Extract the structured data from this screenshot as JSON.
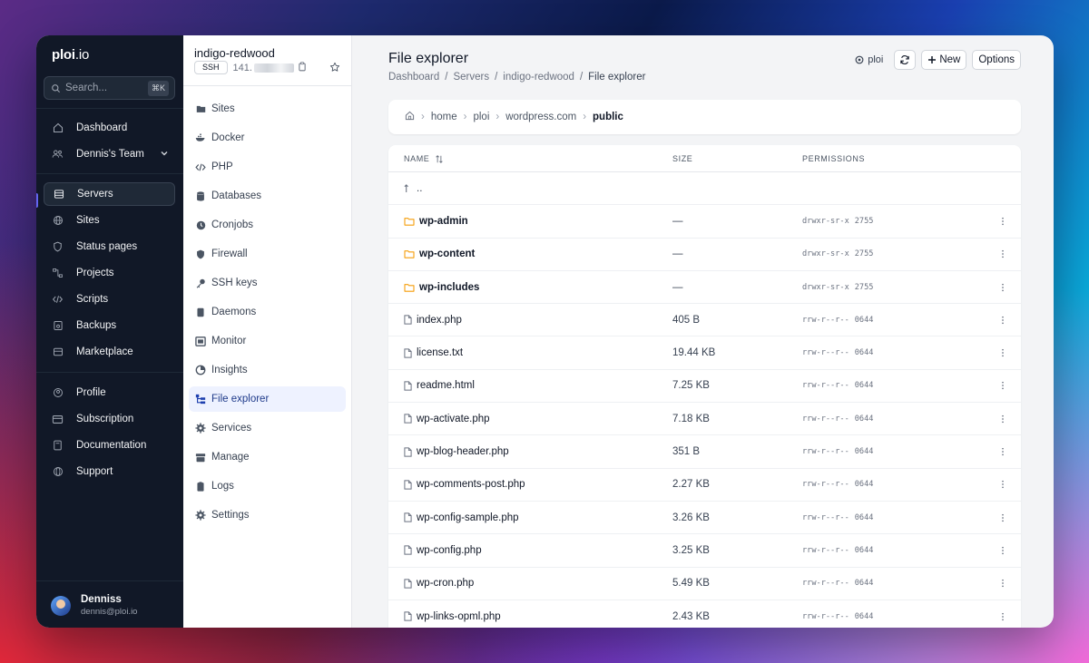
{
  "app": {
    "logo": "ploi",
    "logo_tld": ".io"
  },
  "search": {
    "placeholder": "Search...",
    "shortcut": "⌘K"
  },
  "main_nav": [
    {
      "label": "Dashboard",
      "icon": "home-icon"
    },
    {
      "label": "Dennis's Team",
      "icon": "team-icon",
      "has_dropdown": true
    }
  ],
  "resource_nav": [
    {
      "label": "Servers",
      "icon": "server-icon",
      "active": true
    },
    {
      "label": "Sites",
      "icon": "globe-icon"
    },
    {
      "label": "Status pages",
      "icon": "status-icon"
    },
    {
      "label": "Projects",
      "icon": "projects-icon"
    },
    {
      "label": "Scripts",
      "icon": "code-icon"
    },
    {
      "label": "Backups",
      "icon": "backup-icon"
    },
    {
      "label": "Marketplace",
      "icon": "store-icon"
    }
  ],
  "account_nav": [
    {
      "label": "Profile",
      "icon": "profile-icon"
    },
    {
      "label": "Subscription",
      "icon": "card-icon"
    },
    {
      "label": "Documentation",
      "icon": "book-icon"
    },
    {
      "label": "Support",
      "icon": "support-icon"
    }
  ],
  "user": {
    "name": "Denniss",
    "email": "dennis@ploi.io"
  },
  "server": {
    "name": "indigo-redwood",
    "ssh_label": "SSH",
    "ip_visible": "141."
  },
  "server_nav": [
    {
      "label": "Sites"
    },
    {
      "label": "Docker"
    },
    {
      "label": "PHP"
    },
    {
      "label": "Databases"
    },
    {
      "label": "Cronjobs"
    },
    {
      "label": "Firewall"
    },
    {
      "label": "SSH keys"
    },
    {
      "label": "Daemons"
    },
    {
      "label": "Monitor"
    },
    {
      "label": "Insights"
    },
    {
      "label": "File explorer",
      "active": true
    },
    {
      "label": "Services"
    },
    {
      "label": "Manage"
    },
    {
      "label": "Logs"
    },
    {
      "label": "Settings"
    }
  ],
  "page": {
    "title": "File explorer",
    "breadcrumb": [
      "Dashboard",
      "Servers",
      "indigo-redwood",
      "File explorer"
    ],
    "provider_label": "ploi",
    "new_label": "New",
    "options_label": "Options"
  },
  "path": [
    "home",
    "ploi",
    "wordpress.com",
    "public"
  ],
  "table": {
    "headers": {
      "name": "NAME",
      "size": "SIZE",
      "permissions": "PERMISSIONS"
    },
    "parent_label": "..",
    "rows": [
      {
        "name": "wp-admin",
        "type": "folder",
        "size": "—",
        "perm": "drwxr-sr-x",
        "octal": "2755"
      },
      {
        "name": "wp-content",
        "type": "folder",
        "size": "—",
        "perm": "drwxr-sr-x",
        "octal": "2755"
      },
      {
        "name": "wp-includes",
        "type": "folder",
        "size": "—",
        "perm": "drwxr-sr-x",
        "octal": "2755"
      },
      {
        "name": "index.php",
        "type": "file",
        "size": "405 B",
        "perm": "rrw-r--r--",
        "octal": "0644"
      },
      {
        "name": "license.txt",
        "type": "file",
        "size": "19.44 KB",
        "perm": "rrw-r--r--",
        "octal": "0644"
      },
      {
        "name": "readme.html",
        "type": "file",
        "size": "7.25 KB",
        "perm": "rrw-r--r--",
        "octal": "0644"
      },
      {
        "name": "wp-activate.php",
        "type": "file",
        "size": "7.18 KB",
        "perm": "rrw-r--r--",
        "octal": "0644"
      },
      {
        "name": "wp-blog-header.php",
        "type": "file",
        "size": "351 B",
        "perm": "rrw-r--r--",
        "octal": "0644"
      },
      {
        "name": "wp-comments-post.php",
        "type": "file",
        "size": "2.27 KB",
        "perm": "rrw-r--r--",
        "octal": "0644"
      },
      {
        "name": "wp-config-sample.php",
        "type": "file",
        "size": "3.26 KB",
        "perm": "rrw-r--r--",
        "octal": "0644"
      },
      {
        "name": "wp-config.php",
        "type": "file",
        "size": "3.25 KB",
        "perm": "rrw-r--r--",
        "octal": "0644"
      },
      {
        "name": "wp-cron.php",
        "type": "file",
        "size": "5.49 KB",
        "perm": "rrw-r--r--",
        "octal": "0644"
      },
      {
        "name": "wp-links-opml.php",
        "type": "file",
        "size": "2.43 KB",
        "perm": "rrw-r--r--",
        "octal": "0644"
      }
    ]
  },
  "colors": {
    "accent": "#6366f1",
    "sidebar_bg": "#111827",
    "folder": "#f59e0b",
    "active_bg": "#eef2ff"
  }
}
